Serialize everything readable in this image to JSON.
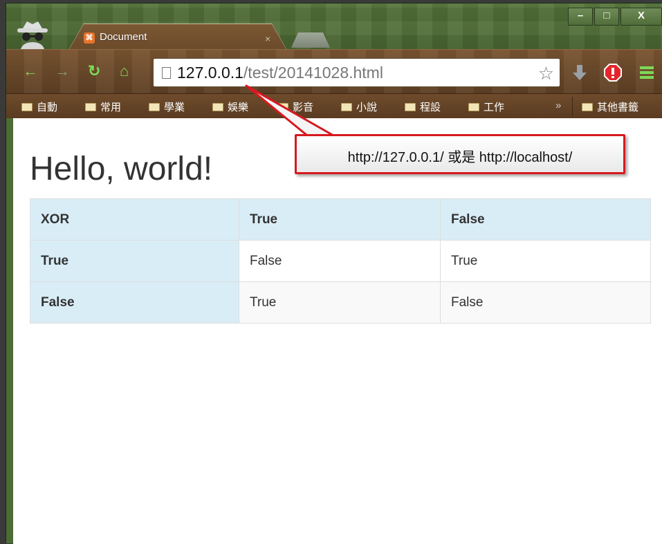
{
  "browser": {
    "tab": {
      "title": "Document",
      "close": "×"
    },
    "window_controls": {
      "minimize": "–",
      "maximize": "□",
      "close": "X"
    },
    "address": {
      "host": "127.0.0.1",
      "path": "/test/20141028.html"
    },
    "bookmarks": [
      "自動",
      "常用",
      "學業",
      "娛樂",
      "影音",
      "小說",
      "程設",
      "工作"
    ],
    "bookmarks_overflow": "»",
    "other_bookmarks": "其他書籤"
  },
  "page": {
    "heading": "Hello, world!",
    "table": {
      "header": [
        "XOR",
        "True",
        "False"
      ],
      "rows": [
        [
          "True",
          "False",
          "True"
        ],
        [
          "False",
          "True",
          "False"
        ]
      ]
    }
  },
  "callout": {
    "text": "http://127.0.0.1/ 或是 http://localhost/"
  },
  "colors": {
    "callout_border": "#d7191f",
    "table_highlight": "#d9edf7",
    "nav_green": "#6fcf3a"
  }
}
